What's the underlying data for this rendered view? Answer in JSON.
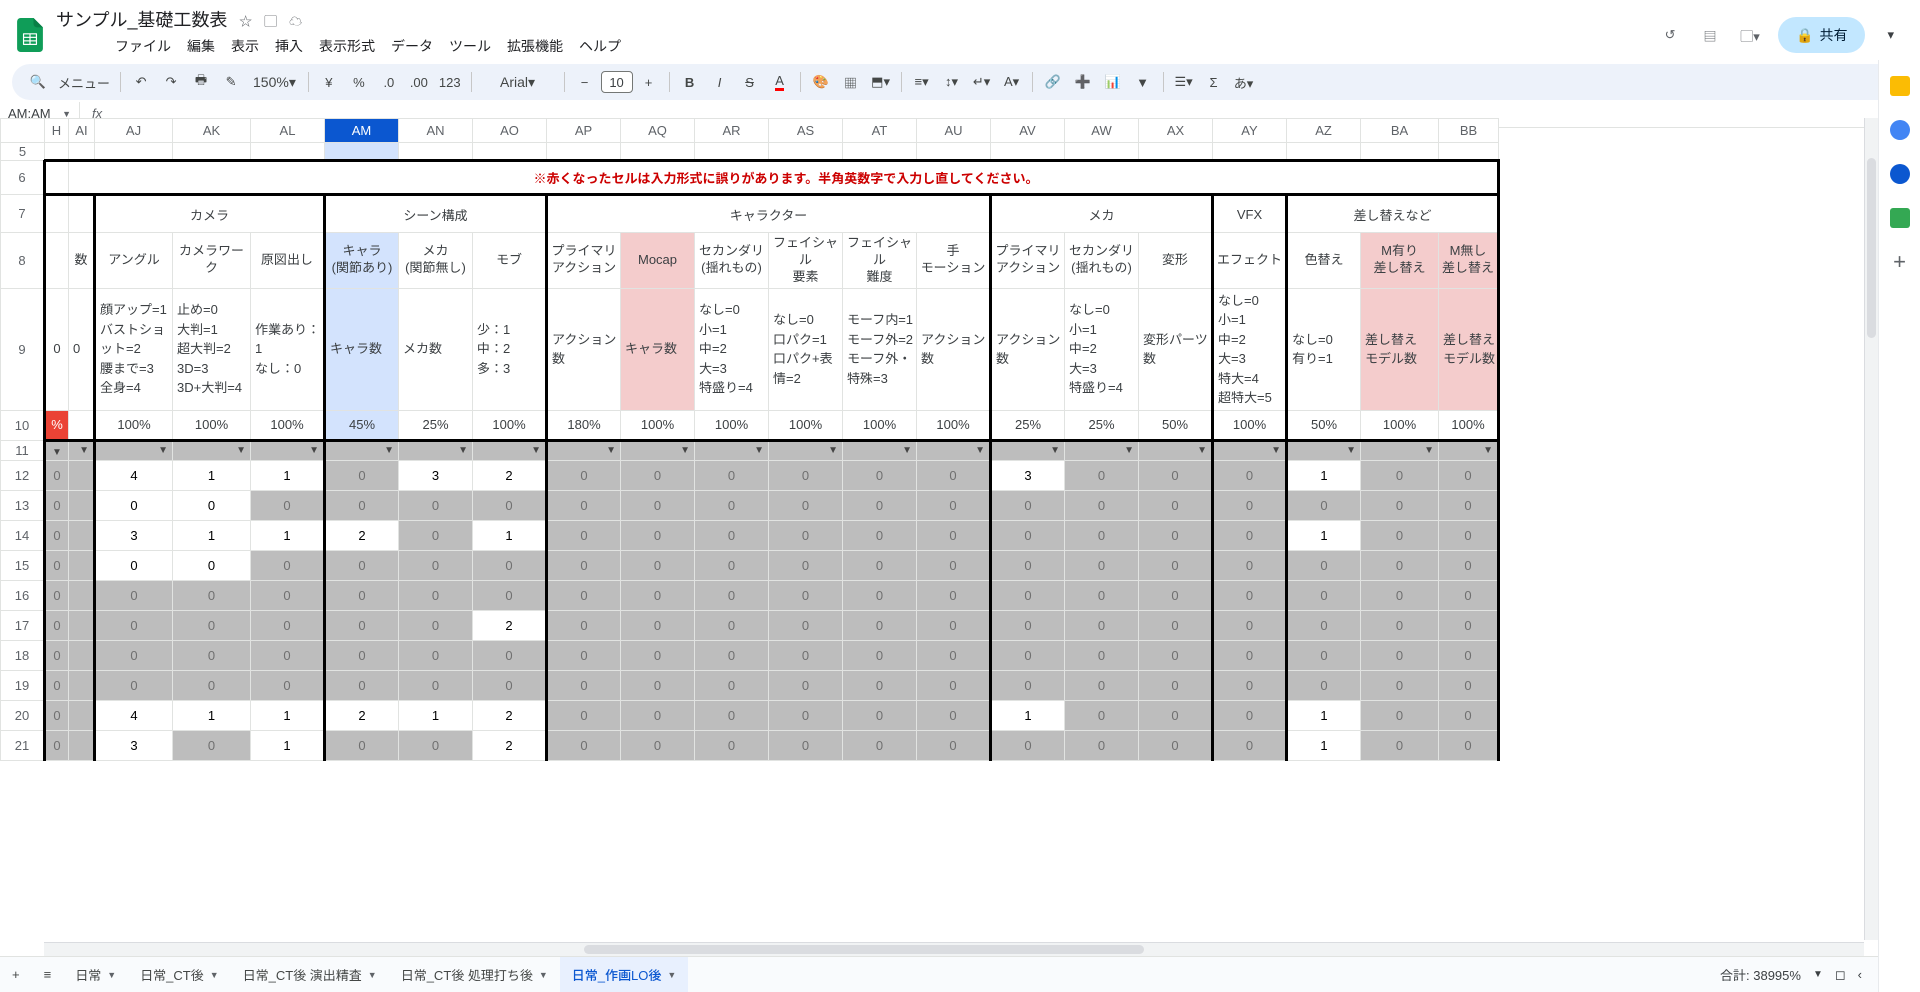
{
  "doc_title": "サンプル_基礎工数表",
  "menus": [
    "ファイル",
    "編集",
    "表示",
    "挿入",
    "表示形式",
    "データ",
    "ツール",
    "拡張機能",
    "ヘルプ"
  ],
  "toolbar": {
    "search_label": "メニュー",
    "zoom": "150%",
    "font": "Arial",
    "font_size": "10"
  },
  "share_label": "共有",
  "name_box": "AM:AM",
  "status": "合計: 38995%",
  "columns": [
    "AI",
    "AJ",
    "AK",
    "AL",
    "AM",
    "AN",
    "AO",
    "AP",
    "AQ",
    "AR",
    "AS",
    "AT",
    "AU",
    "AV",
    "AW",
    "AX",
    "AY",
    "AZ",
    "BA",
    "BB"
  ],
  "row_labels": [
    "5",
    "6",
    "7",
    "8",
    "9",
    "10",
    "11",
    "12",
    "13",
    "14",
    "15",
    "16",
    "17",
    "18",
    "19",
    "20",
    "21"
  ],
  "row6_text": "※赤くなったセルは入力形式に誤りがあります。半角英数字で入力し直してください。",
  "groups": {
    "camera": "カメラ",
    "scene": "シーン構成",
    "character": "キャラクター",
    "mecha": "メカ",
    "vfx": "VFX",
    "replace": "差し替えなど"
  },
  "row8": {
    "AI": "数",
    "AJ": "アングル",
    "AK": "カメラワーク",
    "AL": "原図出し",
    "AM": "キャラ\n(関節あり)",
    "AN": "メカ\n(関節無し)",
    "AO": "モブ",
    "AP": "プライマリ\nアクション",
    "AQ": "Mocap",
    "AR": "セカンダリ\n(揺れもの)",
    "AS": "フェイシャル\n要素",
    "AT": "フェイシャル\n難度",
    "AU": "手\nモーション",
    "AV": "プライマリ\nアクション",
    "AW": "セカンダリ\n(揺れもの)",
    "AX": "変形",
    "AY": "エフェクト",
    "AZ": "色替え",
    "BA": "M有り\n差し替え",
    "BB": "M無し\n差し替え"
  },
  "row9": {
    "AI": "0",
    "AJ": "顔アップ=1\nバストショット=2\n腰まで=3\n全身=4",
    "AK": "止め=0\n大判=1\n超大判=2\n3D=3\n3D+大判=4",
    "AL": "作業あり：1\nなし：0",
    "AM": "キャラ数",
    "AN": "メカ数",
    "AO": "少：1\n中：2\n多：3",
    "AP": "アクション数",
    "AQ": "キャラ数",
    "AR": "なし=0\n小=1\n中=2\n大=3\n特盛り=4",
    "AS": "なし=0\n口パク=1\n口パク+表情=2",
    "AT": "モーフ内=1\nモーフ外=2\nモーフ外・特殊=3",
    "AU": "アクション数",
    "AV": "アクション数",
    "AW": "なし=0\n小=1\n中=2\n大=3\n特盛り=4",
    "AX": "変形パーツ数",
    "AY": "なし=0\n小=1\n中=2\n大=3\n特大=4\n超特大=5",
    "AZ": "なし=0\n有り=1",
    "BA": "差し替え\nモデル数",
    "BB": "差し替え\nモデル数"
  },
  "row10": {
    "cut": "%",
    "AJ": "100%",
    "AK": "100%",
    "AL": "100%",
    "AM": "45%",
    "AN": "25%",
    "AO": "100%",
    "AP": "180%",
    "AQ": "100%",
    "AR": "100%",
    "AS": "100%",
    "AT": "100%",
    "AU": "100%",
    "AV": "25%",
    "AW": "25%",
    "AX": "50%",
    "AY": "100%",
    "AZ": "50%",
    "BA": "100%",
    "BB": "100%"
  },
  "data_rows": [
    {
      "r": "12",
      "cut": "0",
      "AJ": "4",
      "AK": "1",
      "AL": "1",
      "AM": "0",
      "AN": "3",
      "AO": "2",
      "AP": "0",
      "AQ": "0",
      "AR": "0",
      "AS": "0",
      "AT": "0",
      "AU": "0",
      "AV": "3",
      "AW": "0",
      "AX": "0",
      "AY": "0",
      "AZ": "1",
      "BA": "0",
      "BB": "0",
      "white": [
        "AJ",
        "AK",
        "AL",
        "AN",
        "AO",
        "AV",
        "AZ"
      ]
    },
    {
      "r": "13",
      "cut": "0",
      "AJ": "0",
      "AK": "0",
      "AL": "0",
      "AM": "0",
      "AN": "0",
      "AO": "0",
      "AP": "0",
      "AQ": "0",
      "AR": "0",
      "AS": "0",
      "AT": "0",
      "AU": "0",
      "AV": "0",
      "AW": "0",
      "AX": "0",
      "AY": "0",
      "AZ": "0",
      "BA": "0",
      "BB": "0",
      "white": [
        "AJ",
        "AK"
      ]
    },
    {
      "r": "14",
      "cut": "0",
      "AJ": "3",
      "AK": "1",
      "AL": "1",
      "AM": "2",
      "AN": "0",
      "AO": "1",
      "AP": "0",
      "AQ": "0",
      "AR": "0",
      "AS": "0",
      "AT": "0",
      "AU": "0",
      "AV": "0",
      "AW": "0",
      "AX": "0",
      "AY": "0",
      "AZ": "1",
      "BA": "0",
      "BB": "0",
      "white": [
        "AJ",
        "AK",
        "AL",
        "AM",
        "AO",
        "AZ"
      ]
    },
    {
      "r": "15",
      "cut": "0",
      "AJ": "0",
      "AK": "0",
      "AL": "0",
      "AM": "0",
      "AN": "0",
      "AO": "0",
      "AP": "0",
      "AQ": "0",
      "AR": "0",
      "AS": "0",
      "AT": "0",
      "AU": "0",
      "AV": "0",
      "AW": "0",
      "AX": "0",
      "AY": "0",
      "AZ": "0",
      "BA": "0",
      "BB": "0",
      "white": [
        "AJ",
        "AK"
      ]
    },
    {
      "r": "16",
      "cut": "0",
      "AJ": "0",
      "AK": "0",
      "AL": "0",
      "AM": "0",
      "AN": "0",
      "AO": "0",
      "AP": "0",
      "AQ": "0",
      "AR": "0",
      "AS": "0",
      "AT": "0",
      "AU": "0",
      "AV": "0",
      "AW": "0",
      "AX": "0",
      "AY": "0",
      "AZ": "0",
      "BA": "0",
      "BB": "0",
      "white": []
    },
    {
      "r": "17",
      "cut": "0",
      "AJ": "0",
      "AK": "0",
      "AL": "0",
      "AM": "0",
      "AN": "0",
      "AO": "2",
      "AP": "0",
      "AQ": "0",
      "AR": "0",
      "AS": "0",
      "AT": "0",
      "AU": "0",
      "AV": "0",
      "AW": "0",
      "AX": "0",
      "AY": "0",
      "AZ": "0",
      "BA": "0",
      "BB": "0",
      "white": [
        "AO"
      ]
    },
    {
      "r": "18",
      "cut": "0",
      "AJ": "0",
      "AK": "0",
      "AL": "0",
      "AM": "0",
      "AN": "0",
      "AO": "0",
      "AP": "0",
      "AQ": "0",
      "AR": "0",
      "AS": "0",
      "AT": "0",
      "AU": "0",
      "AV": "0",
      "AW": "0",
      "AX": "0",
      "AY": "0",
      "AZ": "0",
      "BA": "0",
      "BB": "0",
      "white": []
    },
    {
      "r": "19",
      "cut": "0",
      "AJ": "0",
      "AK": "0",
      "AL": "0",
      "AM": "0",
      "AN": "0",
      "AO": "0",
      "AP": "0",
      "AQ": "0",
      "AR": "0",
      "AS": "0",
      "AT": "0",
      "AU": "0",
      "AV": "0",
      "AW": "0",
      "AX": "0",
      "AY": "0",
      "AZ": "0",
      "BA": "0",
      "BB": "0",
      "white": []
    },
    {
      "r": "20",
      "cut": "0",
      "AJ": "4",
      "AK": "1",
      "AL": "1",
      "AM": "2",
      "AN": "1",
      "AO": "2",
      "AP": "0",
      "AQ": "0",
      "AR": "0",
      "AS": "0",
      "AT": "0",
      "AU": "0",
      "AV": "1",
      "AW": "0",
      "AX": "0",
      "AY": "0",
      "AZ": "1",
      "BA": "0",
      "BB": "0",
      "white": [
        "AJ",
        "AK",
        "AL",
        "AM",
        "AN",
        "AO",
        "AV",
        "AZ"
      ]
    },
    {
      "r": "21",
      "cut": "0",
      "AJ": "3",
      "AK": "0",
      "AL": "1",
      "AM": "0",
      "AN": "0",
      "AO": "2",
      "AP": "0",
      "AQ": "0",
      "AR": "0",
      "AS": "0",
      "AT": "0",
      "AU": "0",
      "AV": "0",
      "AW": "0",
      "AX": "0",
      "AY": "0",
      "AZ": "1",
      "BA": "0",
      "BB": "0",
      "white": [
        "AJ",
        "AL",
        "AO",
        "AZ"
      ]
    }
  ],
  "tabs": [
    {
      "label": "日常",
      "active": false,
      "drop": true
    },
    {
      "label": "日常_CT後",
      "active": false,
      "drop": true
    },
    {
      "label": "日常_CT後 演出精査",
      "active": false,
      "drop": true
    },
    {
      "label": "日常_CT後 処理打ち後",
      "active": false,
      "drop": true
    },
    {
      "label": "日常_作画LO後",
      "active": true,
      "drop": true
    }
  ]
}
